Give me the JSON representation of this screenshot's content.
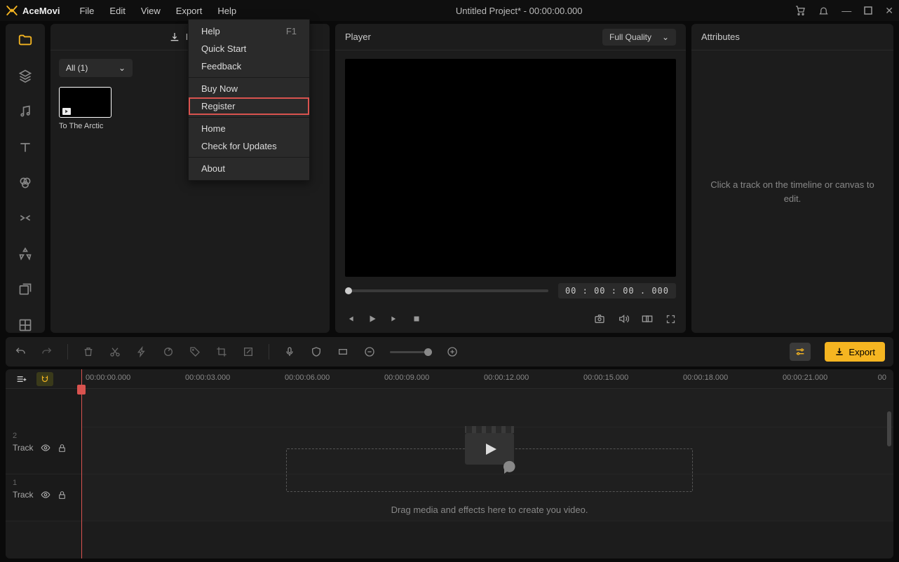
{
  "app_name": "AceMovi",
  "menubar": {
    "file": "File",
    "edit": "Edit",
    "view": "View",
    "export": "Export",
    "help": "Help"
  },
  "title": "Untitled Project* - 00:00:00.000",
  "help_menu": {
    "help": "Help",
    "help_shortcut": "F1",
    "quick_start": "Quick Start",
    "feedback": "Feedback",
    "buy_now": "Buy Now",
    "register": "Register",
    "home": "Home",
    "check_updates": "Check for Updates",
    "about": "About"
  },
  "media": {
    "import_label": "Import",
    "filter": "All (1)",
    "items": [
      {
        "name": "To The Arctic"
      }
    ]
  },
  "player": {
    "title": "Player",
    "quality": "Full Quality",
    "timecode": "00 : 00 : 00 . 000"
  },
  "attributes": {
    "title": "Attributes",
    "placeholder": "Click a track on the timeline or canvas to edit."
  },
  "toolbar": {
    "export": "Export"
  },
  "timeline": {
    "ticks": [
      "00:00:00.000",
      "00:00:03.000",
      "00:00:06.000",
      "00:00:09.000",
      "00:00:12.000",
      "00:00:15.000",
      "00:00:18.000",
      "00:00:21.000"
    ],
    "end_frame": "00",
    "tracks": [
      {
        "num": "2",
        "label": "Track"
      },
      {
        "num": "1",
        "label": "Track"
      }
    ],
    "drop_hint": "Drag media and effects here to create you video."
  }
}
